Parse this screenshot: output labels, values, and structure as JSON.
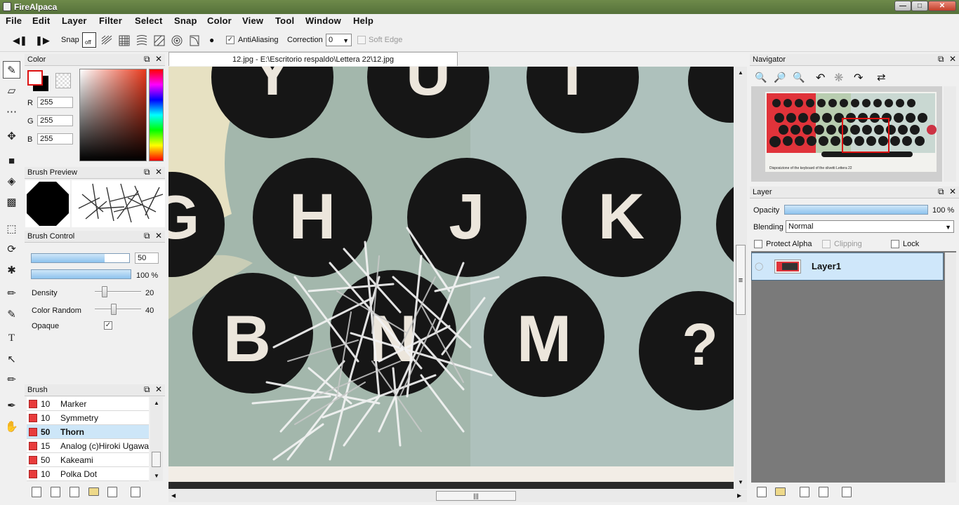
{
  "app": {
    "title": "FireAlpaca"
  },
  "window_controls": {
    "minimize": "—",
    "maximize": "□",
    "close": "✕"
  },
  "menu": [
    "File",
    "Edit",
    "Layer",
    "Filter",
    "Select",
    "Snap",
    "Color",
    "View",
    "Tool",
    "Window",
    "Help"
  ],
  "toolbar": {
    "snap_label": "Snap",
    "snap_off_label": "off",
    "antialiasing_label": "AntiAliasing",
    "antialiasing_checked": true,
    "correction_label": "Correction",
    "correction_value": "0",
    "soft_edge_label": "Soft Edge",
    "soft_edge_checked": false
  },
  "color_panel": {
    "title": "Color",
    "r_label": "R",
    "r_value": "255",
    "g_label": "G",
    "g_value": "255",
    "b_label": "B",
    "b_value": "255",
    "primary_color": "#ffffff",
    "secondary_color": "#000000"
  },
  "brush_preview": {
    "title": "Brush Preview"
  },
  "brush_control": {
    "title": "Brush Control",
    "size_value": "50",
    "size_fraction": 0.75,
    "opacity_value": "100 %",
    "opacity_fraction": 1.0,
    "density_label": "Density",
    "density_value": "20",
    "color_random_label": "Color Random",
    "color_random_value": "40",
    "opaque_label": "Opaque",
    "opaque_checked": true
  },
  "brush_panel": {
    "title": "Brush",
    "items": [
      {
        "size": "10",
        "name": "Marker"
      },
      {
        "size": "10",
        "name": "Symmetry"
      },
      {
        "size": "50",
        "name": "Thorn",
        "selected": true
      },
      {
        "size": "15",
        "name": "Analog (c)Hiroki Ugawa"
      },
      {
        "size": "50",
        "name": "Kakeami"
      },
      {
        "size": "10",
        "name": "Polka Dot"
      }
    ]
  },
  "document": {
    "tab_title": "12.jpg - E:\\Escritorio respaldo\\Lettera 22\\12.jpg",
    "keys": [
      "Y",
      "U",
      "I",
      "G",
      "H",
      "J",
      "K",
      "B",
      "N",
      "M",
      "?"
    ]
  },
  "navigator": {
    "title": "Navigator",
    "caption": "Disposizione of the keyboard of the olivetti Lettera 22"
  },
  "layer_panel": {
    "title": "Layer",
    "opacity_label": "Opacity",
    "opacity_value": "100 %",
    "opacity_fraction": 1.0,
    "blending_label": "Blending",
    "blending_value": "Normal",
    "protect_alpha_label": "Protect Alpha",
    "protect_alpha_checked": false,
    "clipping_label": "Clipping",
    "clipping_checked": false,
    "lock_label": "Lock",
    "lock_checked": false,
    "layers": [
      {
        "name": "Layer1",
        "selected": true
      }
    ]
  },
  "canvas_hscroll_grip": "|||",
  "canvas_vscroll_grip": "≡"
}
